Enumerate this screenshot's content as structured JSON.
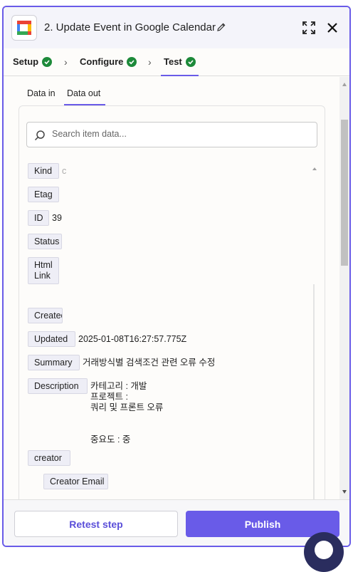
{
  "header": {
    "title": "2. Update Event in Google Calendar",
    "app_icon": "google-calendar-icon",
    "edit_icon": "pencil-icon",
    "expand_icon": "expand-icon",
    "close_icon": "close-icon"
  },
  "steps": [
    {
      "label": "Setup",
      "status": "complete"
    },
    {
      "label": "Configure",
      "status": "complete"
    },
    {
      "label": "Test",
      "status": "complete"
    }
  ],
  "subtabs": {
    "data_in": "Data in",
    "data_out": "Data out",
    "active": "Data out"
  },
  "search": {
    "placeholder": "Search item data..."
  },
  "fields": [
    {
      "key": "Kind",
      "value": "c"
    },
    {
      "key": "Etag",
      "value": ""
    },
    {
      "key": "ID",
      "value": "39"
    },
    {
      "key": "Status",
      "value": ""
    },
    {
      "key": "Html\nLink",
      "value": ""
    },
    {
      "key": "Createc",
      "value": ""
    },
    {
      "key": "Updated",
      "value": "2025-01-08T16:27:57.775Z"
    },
    {
      "key": "Summary",
      "value": "거래방식별 검색조건 관련 오류 수정"
    },
    {
      "key": "Description",
      "value": "카테고리 : 개발\n프로젝트 :\n쿼리 및 프론트 오류\n\n\n중요도 : 중"
    },
    {
      "key": "creator",
      "value": ""
    },
    {
      "key": "Creator Email",
      "value": ""
    }
  ],
  "footer": {
    "retest_label": "Retest step",
    "publish_label": "Publish"
  },
  "colors": {
    "accent": "#695be8",
    "success": "#1d8a3a",
    "key_bg": "#eeeef6"
  }
}
